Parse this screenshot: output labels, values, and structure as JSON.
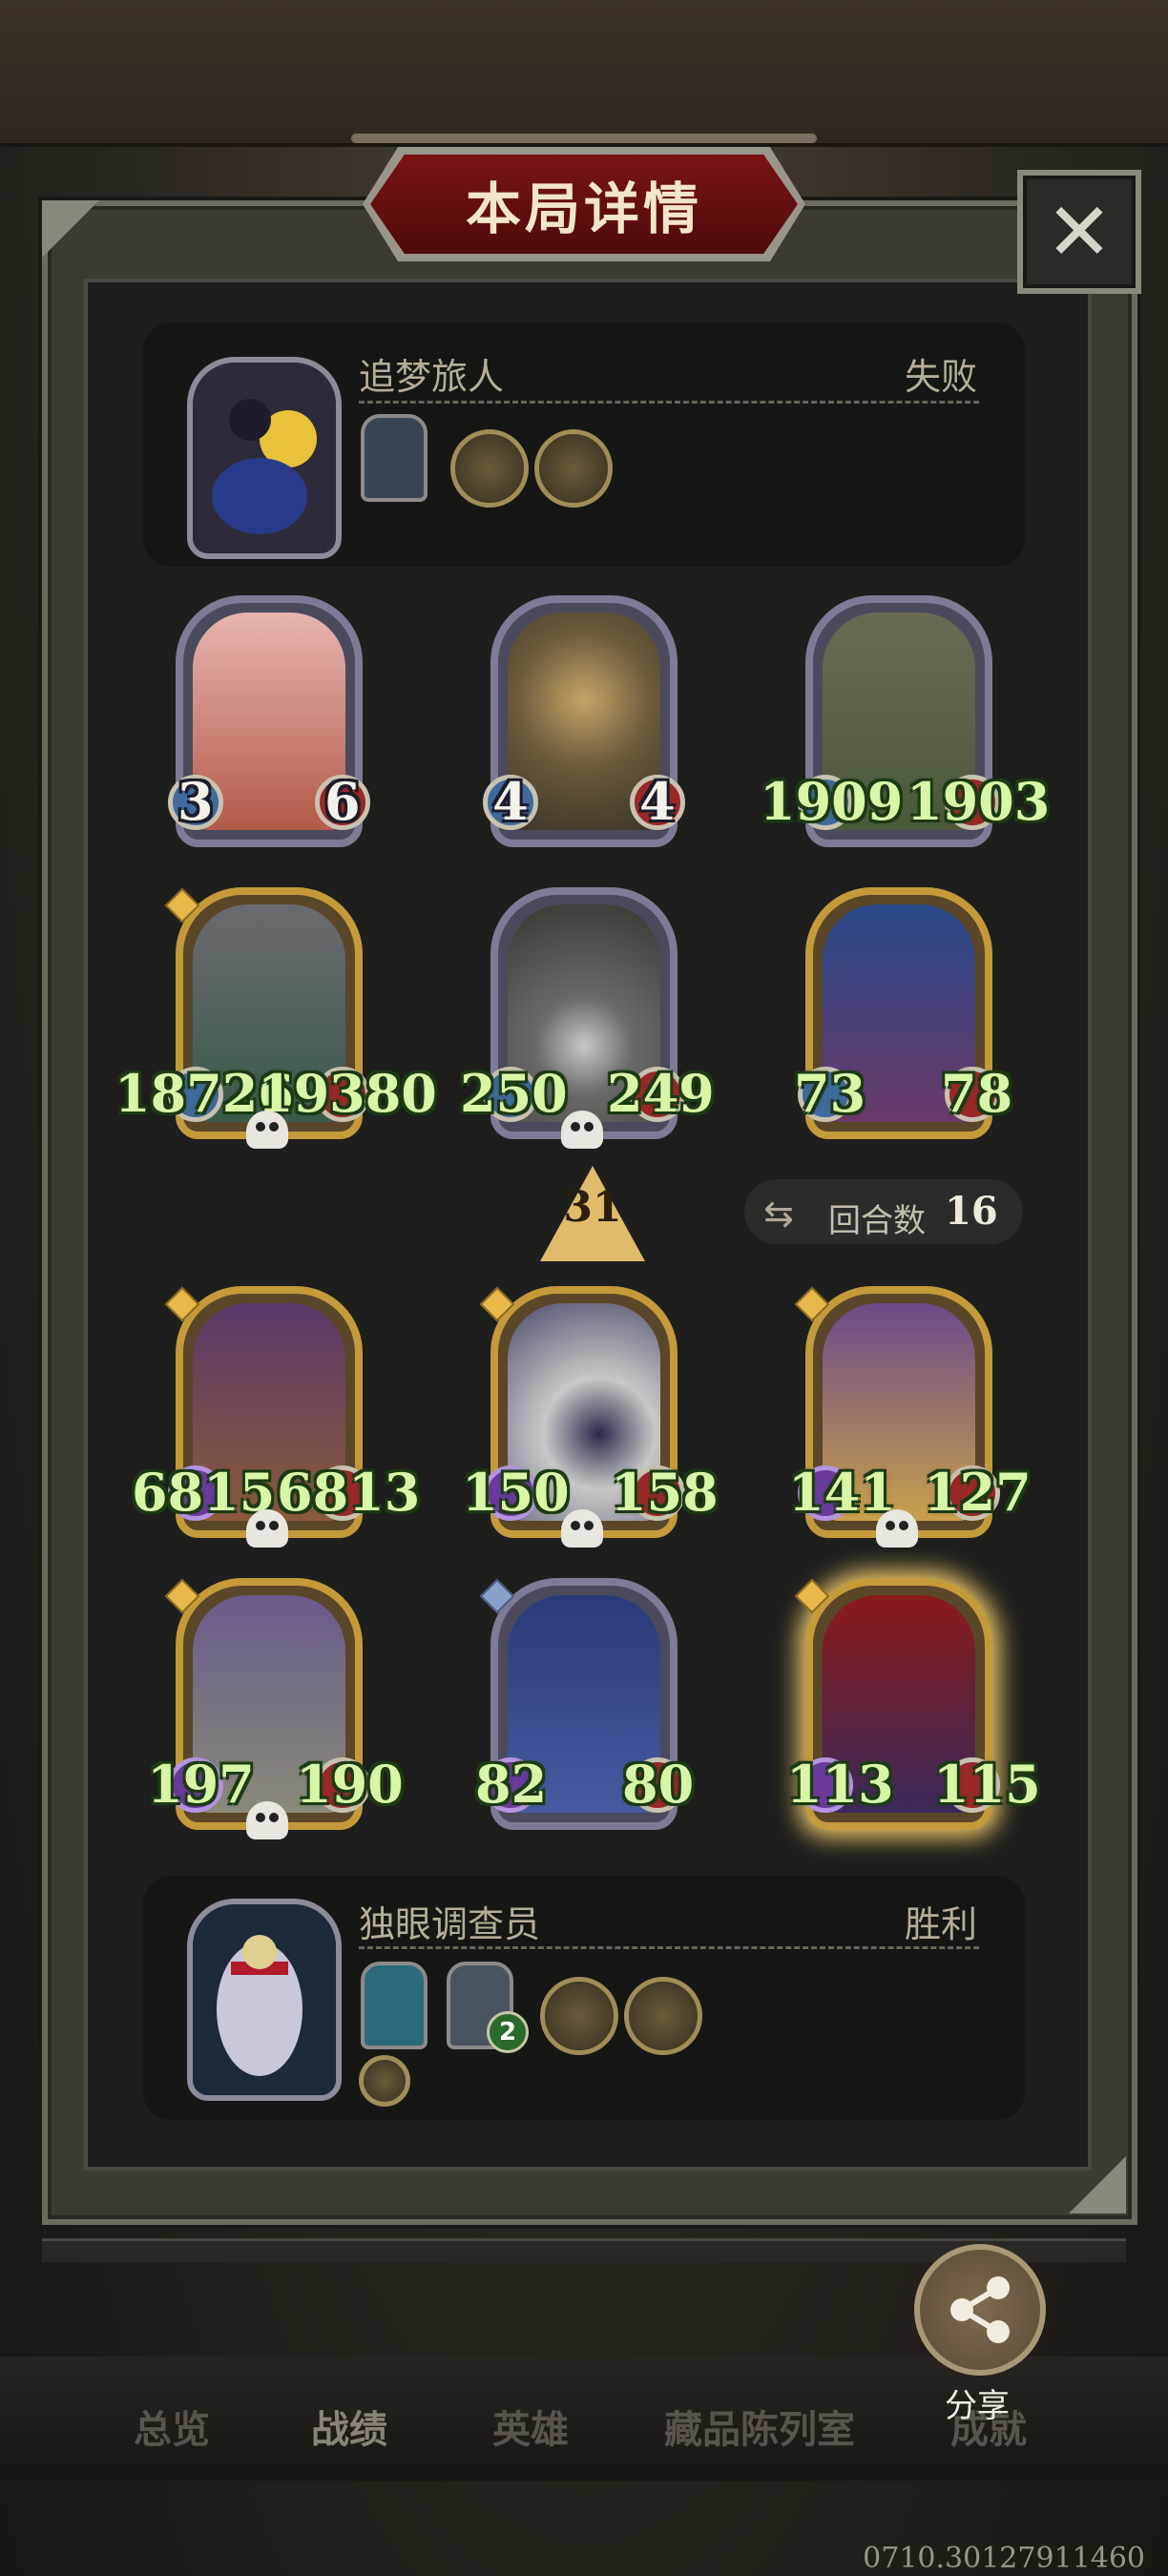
{
  "title": "本局详情",
  "close_icon": "close-icon",
  "opponent": {
    "name": "追梦旅人",
    "result": "失败"
  },
  "player": {
    "name": "独眼调查员",
    "result": "胜利",
    "badge": "2"
  },
  "opponent_board": [
    {
      "attack": "3",
      "health": "6"
    },
    {
      "attack": "4",
      "health": "4"
    },
    {
      "attack": "1909",
      "health": "1903"
    },
    {
      "attack": "18726",
      "health": "19380"
    },
    {
      "attack": "250",
      "health": "249"
    },
    {
      "attack": "73",
      "health": "78"
    }
  ],
  "tier": "31",
  "round": {
    "label": "回合数",
    "value": "16"
  },
  "player_board": [
    {
      "attack": "6815",
      "health": "6813"
    },
    {
      "attack": "150",
      "health": "158"
    },
    {
      "attack": "141",
      "health": "127"
    },
    {
      "attack": "197",
      "health": "190"
    },
    {
      "attack": "82",
      "health": "80"
    },
    {
      "attack": "113",
      "health": "115"
    }
  ],
  "share": {
    "label": "分享",
    "icon": "share-icon"
  },
  "tabs": [
    {
      "label": "总览"
    },
    {
      "label": "战绩"
    },
    {
      "label": "英雄"
    },
    {
      "label": "藏品陈列室"
    },
    {
      "label": "成就"
    }
  ],
  "version": "0710.30127911460"
}
